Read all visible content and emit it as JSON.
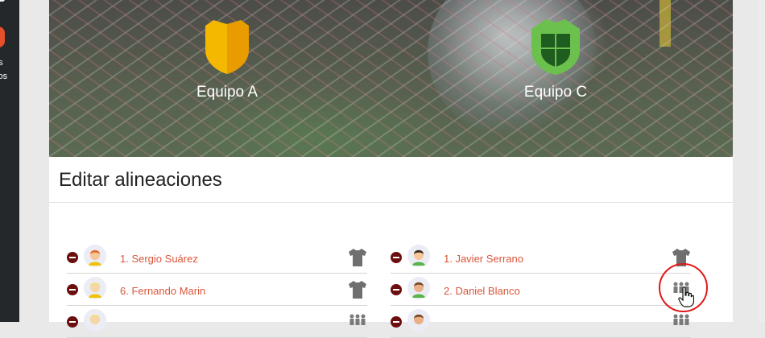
{
  "sidebar": {
    "label_lines": [
      "os",
      "vos"
    ]
  },
  "hero": {
    "teams": [
      {
        "name": "Equipo A",
        "shield_color": "#f5b800",
        "shield_icon": "shield-icon"
      },
      {
        "name": "Equipo C",
        "shield_color": "#5fb548",
        "shield_icon": "shield-icon"
      }
    ]
  },
  "section": {
    "title": "Editar alineaciones"
  },
  "lineups": {
    "left": [
      {
        "name": "1. Sergio Suárez",
        "state_icon": "shirt-icon"
      },
      {
        "name": "6. Fernando Marin",
        "state_icon": "shirt-icon"
      },
      {
        "name": "",
        "state_icon": "substitutes-icon"
      }
    ],
    "right": [
      {
        "name": "1. Javier Serrano",
        "state_icon": "shirt-icon"
      },
      {
        "name": "2. Daniel Blanco",
        "state_icon": "substitutes-icon"
      },
      {
        "name": "",
        "state_icon": "substitutes-icon"
      }
    ]
  },
  "colors": {
    "accent_text": "#d9563a",
    "remove_button": "#6b0e0e",
    "highlight_ring": "#e01818"
  }
}
